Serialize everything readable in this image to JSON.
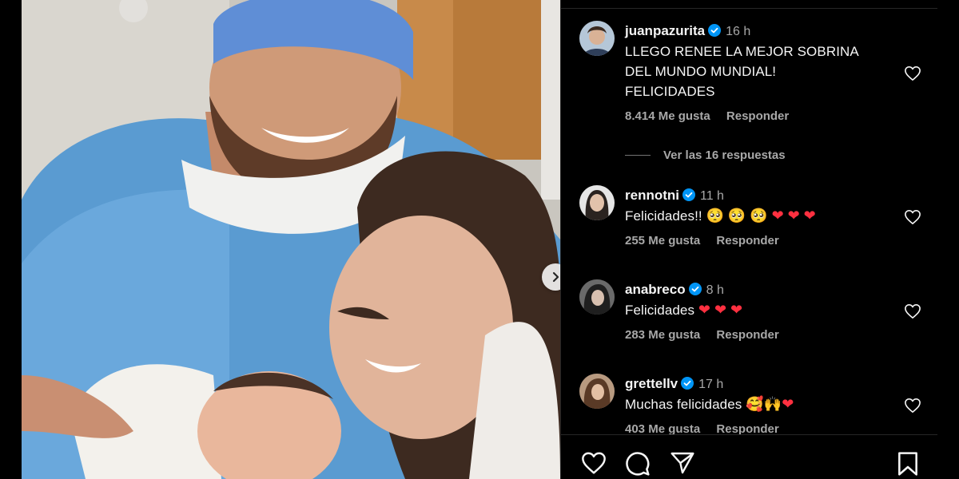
{
  "post": {
    "next_button_icon": "chevron-right-icon"
  },
  "comments": [
    {
      "username": "juanpazurita",
      "verified": true,
      "time": "16 h",
      "text": "LLEGO RENEE LA MEJOR SOBRINA\nDEL MUNDO MUNDIAL!\nFELICIDADES",
      "likes": "8.414 Me gusta",
      "reply": "Responder",
      "view_replies": "Ver las 16 respuestas"
    },
    {
      "username": "rennotni",
      "verified": true,
      "time": "11 h",
      "text": "Felicidades!! ",
      "likes": "255 Me gusta",
      "reply": "Responder"
    },
    {
      "username": "anabreco",
      "verified": true,
      "time": "8 h",
      "text": "Felicidades ",
      "likes": "283 Me gusta",
      "reply": "Responder"
    },
    {
      "username": "grettellv",
      "verified": true,
      "time": "17 h",
      "text": "Muchas felicidades ",
      "likes": "403 Me gusta",
      "reply": "Responder"
    }
  ],
  "emojis": {
    "pleading": "🥺",
    "heart": "❤",
    "smiling_hearts": "🥰",
    "raised_hands": "🙌"
  },
  "colors": {
    "background": "#000000",
    "text": "#f5f5f5",
    "secondary_text": "#a8a8a8",
    "verified_badge": "#0095f6",
    "heart_red": "#ff3040"
  },
  "actions": [
    "like-icon",
    "comment-icon",
    "share-icon",
    "save-icon"
  ]
}
